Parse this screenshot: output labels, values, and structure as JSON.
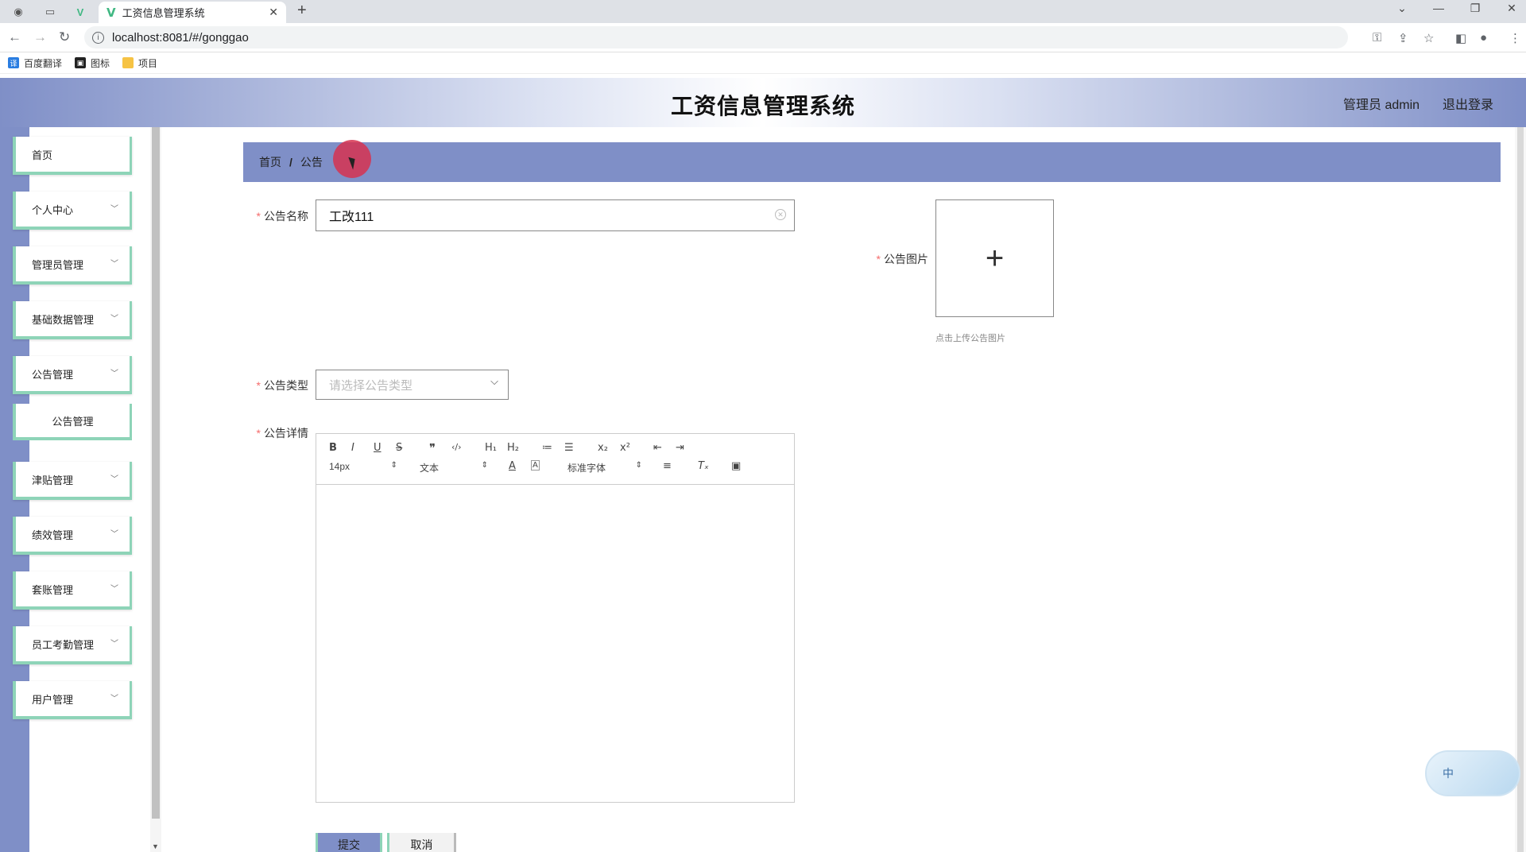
{
  "browser": {
    "tab_title": "工资信息管理系统",
    "url": "localhost:8081/#/gonggao",
    "bookmarks": [
      "百度翻译",
      "图标",
      "项目"
    ]
  },
  "header": {
    "title": "工资信息管理系统",
    "admin_label": "管理员 admin",
    "logout_label": "退出登录"
  },
  "sidebar": {
    "items": [
      {
        "label": "首页"
      },
      {
        "label": "个人中心"
      },
      {
        "label": "管理员管理"
      },
      {
        "label": "基础数据管理"
      },
      {
        "label": "公告管理"
      },
      {
        "label": "津贴管理"
      },
      {
        "label": "绩效管理"
      },
      {
        "label": "套账管理"
      },
      {
        "label": "员工考勤管理"
      },
      {
        "label": "用户管理"
      }
    ],
    "subitem": "公告管理"
  },
  "breadcrumb": {
    "home": "首页",
    "separator": "/",
    "current": "公告"
  },
  "form": {
    "name_label": "公告名称",
    "name_value": "工改111",
    "image_label": "公告图片",
    "upload_hint": "点击上传公告图片",
    "type_label": "公告类型",
    "type_placeholder": "请选择公告类型",
    "detail_label": "公告详情",
    "submit_label": "提交",
    "cancel_label": "取消"
  },
  "editor": {
    "size_value": "14px",
    "header_value": "文本",
    "font_value": "标准字体"
  },
  "ime": {
    "label": "中"
  },
  "colors": {
    "accent": "#7f8fc7",
    "menu_border": "#8ed4b8",
    "required": "#f56c6c"
  }
}
